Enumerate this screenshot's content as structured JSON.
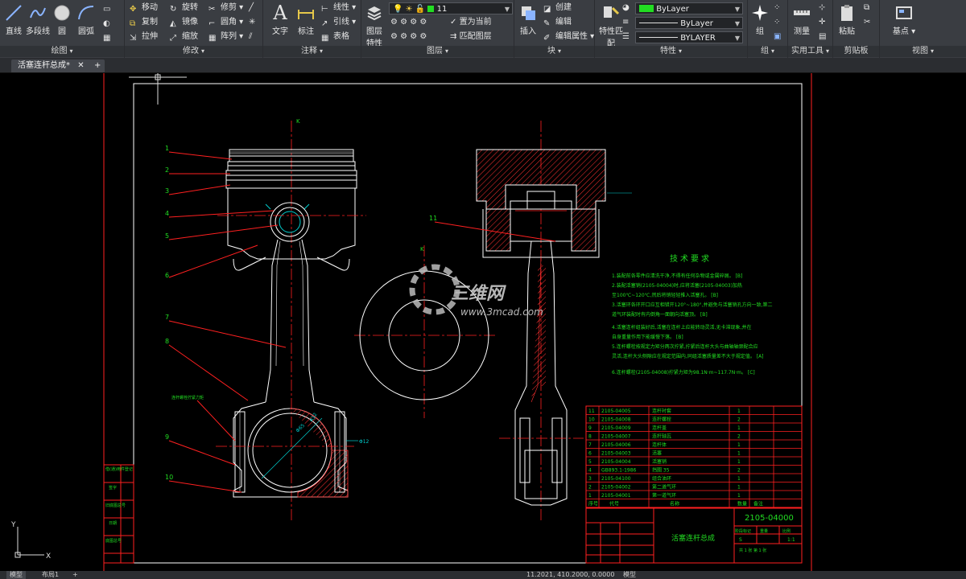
{
  "ribbon": {
    "draw": {
      "title": "绘图",
      "line": "直线",
      "polyline": "多段线",
      "circle": "圆",
      "arc": "圆弧"
    },
    "modify": {
      "title": "修改",
      "move": "移动",
      "rotate": "旋转",
      "trim": "修剪",
      "copy": "复制",
      "mirror": "镜像",
      "fillet": "圆角",
      "stretch": "拉伸",
      "scale": "缩放",
      "array": "阵列"
    },
    "annotation": {
      "title": "注释",
      "text": "文字",
      "dimension": "标注",
      "linear": "线性",
      "leader": "引线",
      "table": "表格"
    },
    "layers": {
      "title": "图层",
      "layer_props": "图层特性",
      "layer_value": "11",
      "set_current": "置为当前",
      "match_layer": "匹配图层"
    },
    "block": {
      "title": "块",
      "insert": "插入",
      "create": "创建",
      "edit": "编辑",
      "edit_attr": "编辑属性"
    },
    "properties": {
      "title": "特性",
      "match": "特性匹配",
      "color_value": "ByLayer",
      "linetype_value": "ByLayer",
      "lineweight_value": "BYLAYER"
    },
    "groups": {
      "title": "组",
      "group": "组"
    },
    "utilities": {
      "title": "实用工具",
      "measure": "测量"
    },
    "clipboard": {
      "title": "剪贴板",
      "paste": "粘贴"
    },
    "view": {
      "title": "视图",
      "base": "基点"
    }
  },
  "tabs": {
    "file_tab": "活塞连杆总成*",
    "add_tab": "+"
  },
  "drawing": {
    "section_mark": "K",
    "section_mark2": "K",
    "callouts": [
      "1",
      "2",
      "3",
      "4",
      "5",
      "6",
      "7",
      "8",
      "9",
      "10"
    ],
    "callout_11": "11",
    "side_note": "连杆螺栓拧紧力矩",
    "dim_d": "Φ65",
    "dim_r": "R12",
    "dim_b": "Φ12",
    "tech_title": "技术要求",
    "tech_lines": [
      "1.装配前各零件应清洗干净,不得有任何杂物或金属碎屑。 [B]",
      "2.装配活塞销(2105-04004)时,应将活塞(2105-04003)加热",
      "  至100℃~120℃,然后将销轻轻推入活塞孔。 [B]",
      "3.活塞环各环开口应互相错开120°~180°,并避免与活塞销孔方向一致,第二",
      "  道气环装配时有内倒角一面朝向活塞顶。 [B]",
      "4.活塞连杆组装好后,活塞在连杆上应能转动灵活,无卡滞现象,并在",
      "  自身重量作用下能缓慢下落。 [B]",
      "5.连杆螺栓按规定力矩分两次拧紧,拧紧后连杆大头与曲轴轴颈配合应",
      "  灵活,连杆大头侧隙应在规定范围内,同组活塞质量差不大于规定值。 [A]",
      "6.连杆螺栓(2105-04008)拧紧力矩为98.1N·m~117.7N·m。 [C]"
    ],
    "watermark_cn": "三维网",
    "watermark_url": "www.3mcad.com",
    "bom_rows": [
      [
        "11",
        "2105-04005",
        "连杆衬套",
        "1",
        ""
      ],
      [
        "10",
        "2105-04008",
        "连杆螺栓",
        "2",
        ""
      ],
      [
        "9",
        "2105-04009",
        "连杆盖",
        "1",
        ""
      ],
      [
        "8",
        "2105-04007",
        "连杆轴瓦",
        "2",
        ""
      ],
      [
        "7",
        "2105-04006",
        "连杆体",
        "1",
        ""
      ],
      [
        "6",
        "2105-04003",
        "活塞",
        "1",
        ""
      ],
      [
        "5",
        "2105-04004",
        "活塞销",
        "1",
        ""
      ],
      [
        "4",
        "GB893.1-1986",
        "挡圈 35",
        "2",
        ""
      ],
      [
        "3",
        "2105-04100",
        "组合油环",
        "1",
        ""
      ],
      [
        "2",
        "2105-04002",
        "第二道气环",
        "1",
        ""
      ],
      [
        "1",
        "2105-04001",
        "第一道气环",
        "1",
        ""
      ]
    ],
    "bom_header": [
      "序号",
      "代号",
      "名称",
      "数量",
      "备注"
    ],
    "drawing_no": "2105-04000",
    "drawing_title": "活塞连杆总成",
    "scale_labels": [
      "阶段标记",
      "重量",
      "比例"
    ],
    "scale_values": [
      "S",
      "",
      "1:1"
    ],
    "sheet_info": "共 1 张 第 1 张",
    "left_title_labels": [
      "借(通)用件登记",
      "旧底图总号",
      "底图总号",
      "签字",
      "日期"
    ]
  },
  "ucs": {
    "y": "Y",
    "x": "X"
  },
  "status": {
    "model_tab": "模型",
    "layout_tab": "布局1",
    "add": "+",
    "coords": "11.2021, 410.2000, 0.0000",
    "model_btn": "模型"
  },
  "colors": {
    "red": "#ff2020",
    "white": "#ffffff",
    "green": "#22dd22",
    "cyan": "#00d0d0",
    "yellow": "#e8e800",
    "hatch": "#ff3030"
  }
}
